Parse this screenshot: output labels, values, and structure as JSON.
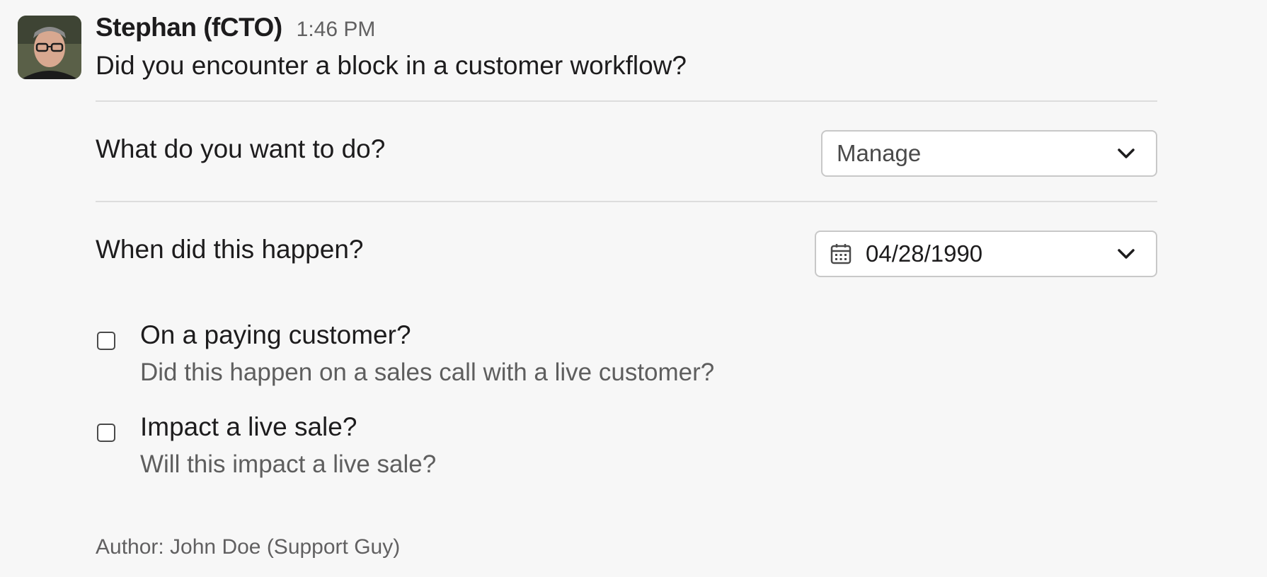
{
  "message": {
    "sender": "Stephan (fCTO)",
    "timestamp": "1:46 PM",
    "text": "Did you encounter a block in a customer workflow?"
  },
  "form": {
    "action": {
      "label": "What do you want to do?",
      "selected": "Manage",
      "icon": "chevron-down-icon"
    },
    "date": {
      "label": "When did this happen?",
      "value": "04/28/1990",
      "icon": "calendar-icon"
    },
    "checkboxes": [
      {
        "label": "On a paying customer?",
        "description": "Did this happen on a sales call with a live customer?",
        "checked": false
      },
      {
        "label": "Impact a live sale?",
        "description": "Will this impact a live sale?",
        "checked": false
      }
    ]
  },
  "footer": {
    "author": "Author: John Doe (Support Guy)"
  }
}
